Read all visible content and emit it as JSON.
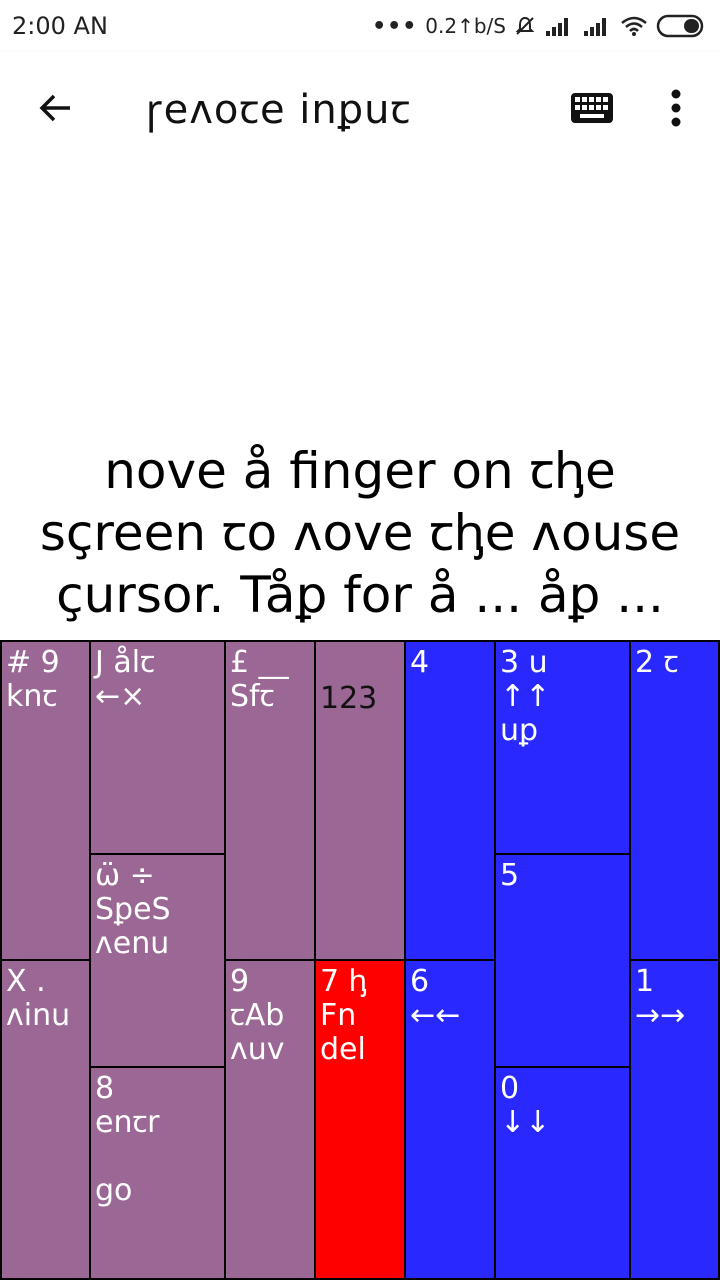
{
  "status_bar": {
    "time": "2:00 AN",
    "dots": "•••",
    "speed": "0.2↑b/S"
  },
  "app_bar": {
    "title": "ꞅeʌoꞇe inꝑuꞇ"
  },
  "touchpad": {
    "instruction": "nove å finger on ꞇꞕe sçreen ꞇo ʌove ꞇꞕe ʌouse çursor. Tåꝑ for å ... åꝑ ... "
  },
  "keys": {
    "k1": "# 9\nknꞇ",
    "k2": "J ålꞇ\n←×",
    "k3": "£ __\nSfꞇ",
    "k4": "123",
    "k5": "4",
    "k6": "3 u\n↑↑\nuꝑ",
    "k7": "2 ꞇ",
    "k8": "ω̈ ÷\nSꝑeS\nʌenu",
    "k9": "5",
    "k10": "X .\nʌinu",
    "k11": "9\nꞇAb\nʌuv",
    "k12": "7 ꞕ\nFn\ndel",
    "k13": "6\n←←",
    "k14": "1\n→→",
    "k15": "8\nenꞇr\n\ngo",
    "k16": "0\n↓↓"
  },
  "colors": {
    "purple": "#9b6794",
    "blue": "#2828ff",
    "red": "#ff0000"
  },
  "icons": {
    "back": "arrow-left-icon",
    "keyboard": "keyboard-icon",
    "more": "more-vertical-icon"
  }
}
